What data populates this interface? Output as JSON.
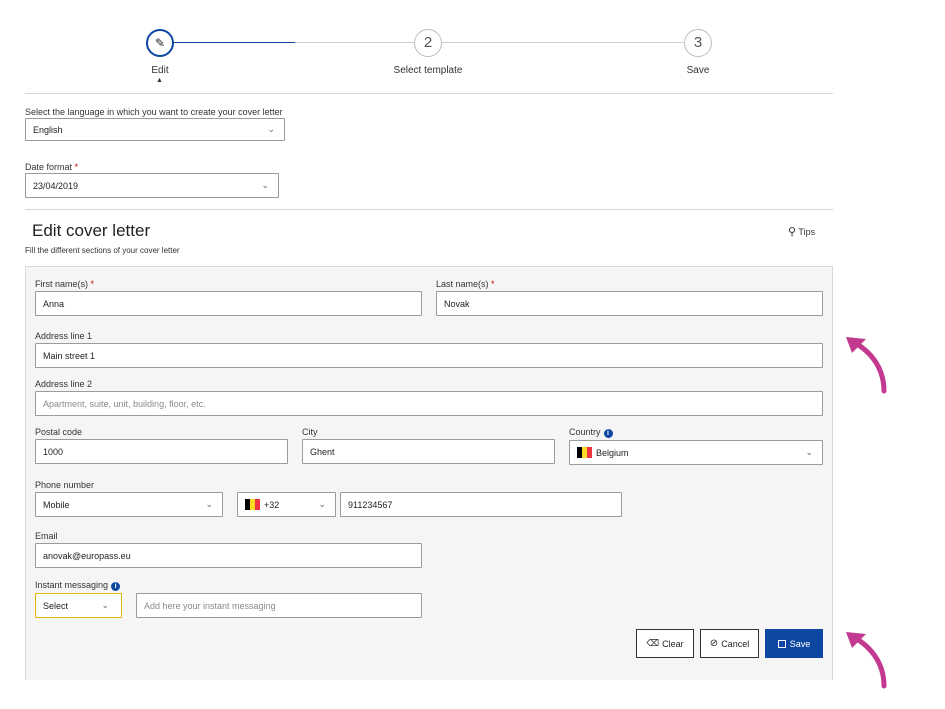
{
  "stepper": {
    "steps": [
      {
        "number": "",
        "label": "Edit"
      },
      {
        "number": "2",
        "label": "Select template"
      },
      {
        "number": "3",
        "label": "Save"
      }
    ]
  },
  "language": {
    "label": "Select the language in which you want to create your cover letter",
    "value": "English"
  },
  "date_format": {
    "label": "Date format",
    "required_mark": "*",
    "value": "23/04/2019"
  },
  "section": {
    "title": "Edit cover letter",
    "subtitle": "Fill the different sections of your cover letter",
    "tips_label": "Tips"
  },
  "form": {
    "first_name": {
      "label": "First name(s)",
      "required_mark": "*",
      "value": "Anna"
    },
    "last_name": {
      "label": "Last name(s)",
      "required_mark": "*",
      "value": "Novak"
    },
    "address1": {
      "label": "Address line 1",
      "value": "Main street 1"
    },
    "address2": {
      "label": "Address line 2",
      "placeholder": "Apartment, suite, unit, building, floor, etc."
    },
    "postal_code": {
      "label": "Postal code",
      "value": "1000"
    },
    "city": {
      "label": "City",
      "value": "Ghent"
    },
    "country": {
      "label": "Country",
      "value": "Belgium"
    },
    "phone": {
      "label": "Phone number",
      "type": "Mobile",
      "code": "+32",
      "number": "911234567"
    },
    "email": {
      "label": "Email",
      "value": "anovak@europass.eu"
    },
    "im": {
      "label": "Instant messaging",
      "type": "Select",
      "placeholder": "Add here your instant messaging"
    }
  },
  "buttons": {
    "clear": "Clear",
    "cancel": "Cancel",
    "save": "Save"
  },
  "colors": {
    "primary": "#0e47a1",
    "annotation_arrow": "#c2398f",
    "flag_black": "#000000",
    "flag_yellow": "#fdda24",
    "flag_red": "#ef3340"
  }
}
